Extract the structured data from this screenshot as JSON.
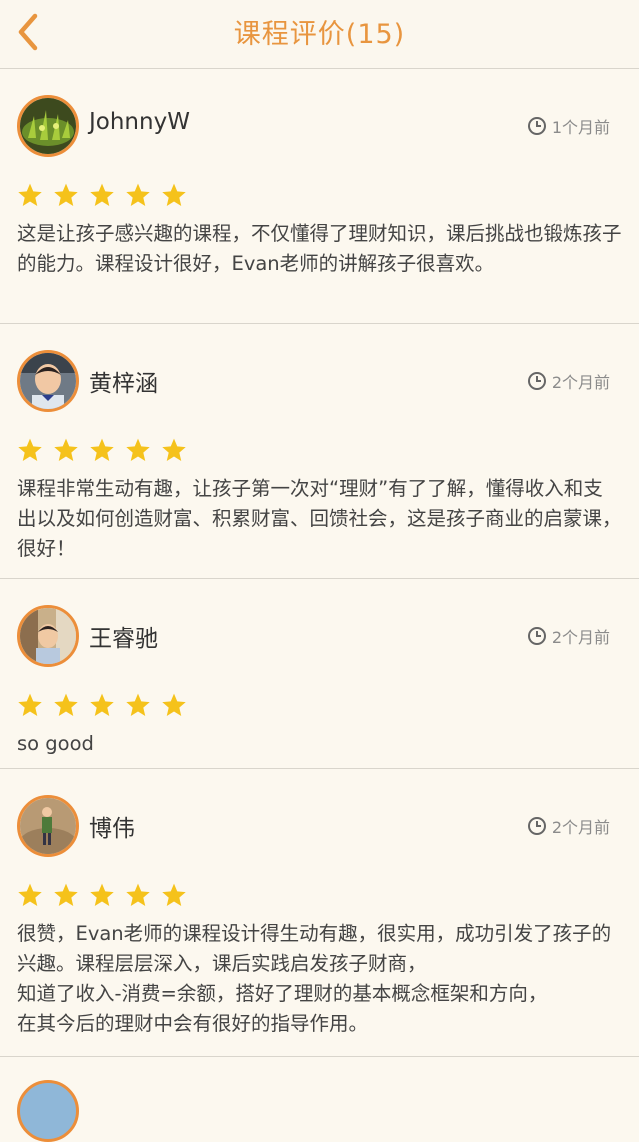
{
  "header": {
    "title": "课程评价(15)",
    "back_icon": "chevron-left-icon",
    "accent": "#e8953f"
  },
  "reviews": [
    {
      "name": "JohnnyW",
      "time": "1个月前",
      "rating": 5,
      "content": "这是让孩子感兴趣的课程，不仅懂得了理财知识，课后挑战也锻炼孩子的能力。课程设计很好，Evan老师的讲解孩子很喜欢。"
    },
    {
      "name": "黄梓涵",
      "time": "2个月前",
      "rating": 5,
      "content": "课程非常生动有趣，让孩子第一次对“理财”有了了解，懂得收入和支出以及如何创造财富、积累财富、回馈社会，这是孩子商业的启蒙课，很好！"
    },
    {
      "name": "王睿驰",
      "time": "2个月前",
      "rating": 5,
      "content": "so good"
    },
    {
      "name": "博伟",
      "time": "2个月前",
      "rating": 5,
      "content": "很赞，Evan老师的课程设计得生动有趣，很实用，成功引发了孩子的兴趣。课程层层深入，课后实践启发孩子财商，\n知道了收入-消费=余额，搭好了理财的基本概念框架和方向，\n在其今后的理财中会有很好的指导作用。"
    }
  ],
  "colors": {
    "star": "#f5c21b",
    "avatar_border": "#ec8e3a",
    "background": "#fcf8ef"
  }
}
